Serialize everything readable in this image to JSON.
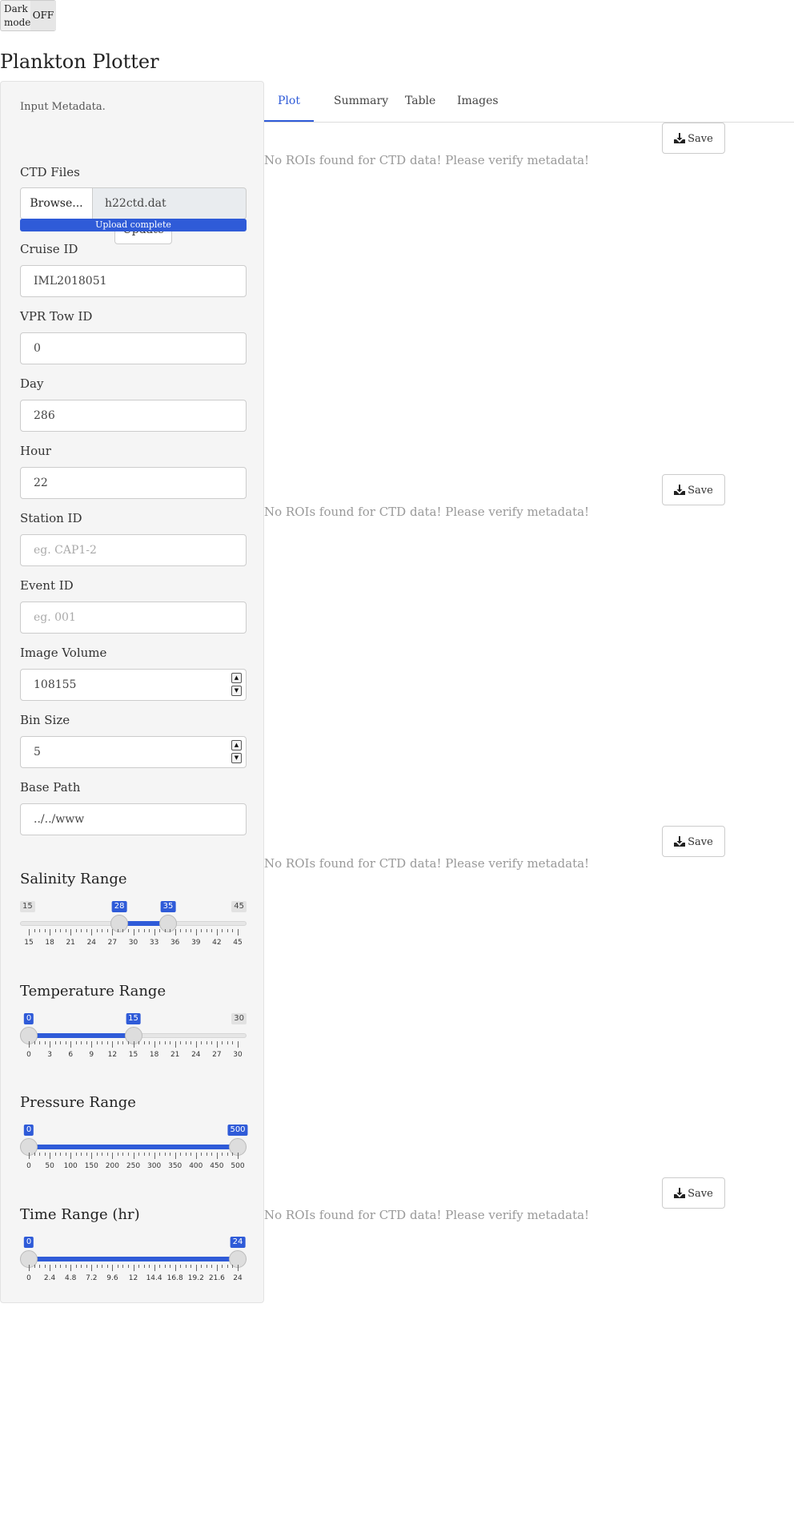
{
  "dark_mode": {
    "label": "Dark mode",
    "state": "OFF"
  },
  "app": {
    "title": "Plankton Plotter"
  },
  "sidebar": {
    "input_metadata_label": "Input Metadata.",
    "update_label": "Update",
    "ctd_files": {
      "label": "CTD Files",
      "browse_label": "Browse...",
      "file_name": "h22ctd.dat",
      "progress_text": "Upload complete",
      "progress": 1.0
    },
    "fields": {
      "cruise_id": {
        "label": "Cruise ID",
        "value": "IML2018051"
      },
      "vpr_tow_id": {
        "label": "VPR Tow ID",
        "value": "0"
      },
      "day": {
        "label": "Day",
        "value": "286"
      },
      "hour": {
        "label": "Hour",
        "value": "22"
      },
      "station_id": {
        "label": "Station ID",
        "value": "",
        "placeholder": "eg. CAP1-2"
      },
      "event_id": {
        "label": "Event ID",
        "value": "",
        "placeholder": "eg. 001"
      },
      "image_volume": {
        "label": "Image Volume",
        "value": "108155"
      },
      "bin_size": {
        "label": "Bin Size",
        "value": "5"
      },
      "base_path": {
        "label": "Base Path",
        "value": "../../www"
      }
    },
    "sliders": {
      "salinity": {
        "label": "Salinity Range",
        "min": 15,
        "max": 45,
        "from": 28,
        "to": 35,
        "ticks": [
          "15",
          "18",
          "21",
          "24",
          "27",
          "30",
          "33",
          "36",
          "39",
          "42",
          "45"
        ]
      },
      "temperature": {
        "label": "Temperature Range",
        "min": 0,
        "max": 30,
        "from": 0,
        "to": 15,
        "ticks": [
          "0",
          "3",
          "6",
          "9",
          "12",
          "15",
          "18",
          "21",
          "24",
          "27",
          "30"
        ]
      },
      "pressure": {
        "label": "Pressure Range",
        "min": 0,
        "max": 500,
        "from": 0,
        "to": 500,
        "ticks": [
          "0",
          "50",
          "100",
          "150",
          "200",
          "250",
          "300",
          "350",
          "400",
          "450",
          "500"
        ]
      },
      "time": {
        "label": "Time Range (hr)",
        "min": 0,
        "max": 24,
        "from": 0,
        "to": 24,
        "ticks": [
          "0",
          "2.4",
          "4.8",
          "7.2",
          "9.6",
          "12",
          "14.4",
          "16.8",
          "19.2",
          "21.6",
          "24"
        ]
      }
    }
  },
  "tabs": [
    "Plot",
    "Summary",
    "Table",
    "Images"
  ],
  "active_tab": "Plot",
  "plots": [
    {
      "save_label": "Save",
      "message": "No ROIs found for CTD data! Please verify metadata!"
    },
    {
      "save_label": "Save",
      "message": "No ROIs found for CTD data! Please verify metadata!"
    },
    {
      "save_label": "Save",
      "message": "No ROIs found for CTD data! Please verify metadata!"
    },
    {
      "save_label": "Save",
      "message": "No ROIs found for CTD data! Please verify metadata!"
    }
  ],
  "colors": {
    "accent": "#2f5bd8",
    "panel": "#f5f5f5",
    "muted_text": "#999999"
  }
}
